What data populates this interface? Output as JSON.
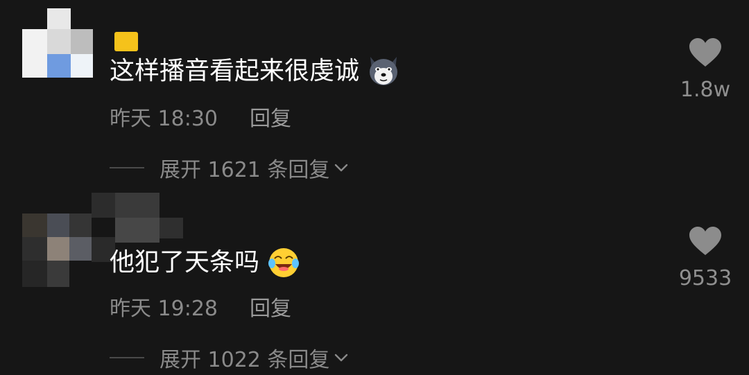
{
  "comments": [
    {
      "text": "这样播音看起来很虔诚",
      "emoji_icon": "husky-dog-emoji",
      "time": "昨天 18:30",
      "reply_label": "回复",
      "expand_label": "展开 1621 条回复",
      "like_count": "1.8w"
    },
    {
      "text": "他犯了天条吗",
      "emoji_icon": "crying-laughing-emoji",
      "time": "昨天 19:28",
      "reply_label": "回复",
      "expand_label": "展开 1022 条回复",
      "like_count": "9533"
    }
  ],
  "colors": {
    "background": "#161616",
    "text_primary": "#ffffff",
    "text_secondary": "#8a8a8a",
    "badge": "#f5c21b",
    "heart": "#8c8c8c"
  }
}
